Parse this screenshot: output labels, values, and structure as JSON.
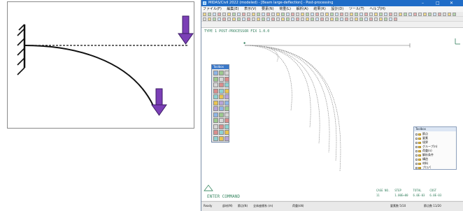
{
  "app": {
    "title": "MIDAS/Civil 2022 (modeled) - [Beam large-deflection] - Post-processing",
    "window_controls": [
      "–",
      "□",
      "✕"
    ],
    "menu": [
      "ファイル(F)",
      "編集(E)",
      "表示(V)",
      "要素(N)",
      "荷重(L)",
      "解析(A)",
      "結果(R)",
      "設計(D)",
      "ツール(T)",
      "ヘルプ(H)"
    ]
  },
  "viewport": {
    "mode_text": "TYPE 1   POST-PROCESSOR   FIX  1.0.0",
    "command_prompt": "ENTER  COMMAND",
    "stats": {
      "headers": [
        "CASE NO.",
        "STEP",
        "TOTAL",
        "COST"
      ],
      "values": [
        "11",
        "1.00E+00",
        "6.0E-03",
        "6.0E-03"
      ]
    }
  },
  "toolbox": {
    "title": "Toolbox"
  },
  "tree_panel": {
    "title": "Toolbox",
    "items": [
      "節点",
      "要素",
      "境界",
      "グループ(n)",
      "荷重(n)",
      "解析条件",
      "構造",
      "材料",
      "プロパ"
    ]
  },
  "statusbar": {
    "items": [
      "Ready",
      "部材(M)",
      "節点(N)",
      "全体座標系 (m)",
      "荷重(kN)",
      "要素数 5/10",
      "節点数 11/20"
    ]
  },
  "colors": {
    "load_arrow": "#7b3fb6",
    "beam_curve": "#222222",
    "titlebar": "#1f6cc7",
    "prompt_text": "#3d8a66"
  }
}
